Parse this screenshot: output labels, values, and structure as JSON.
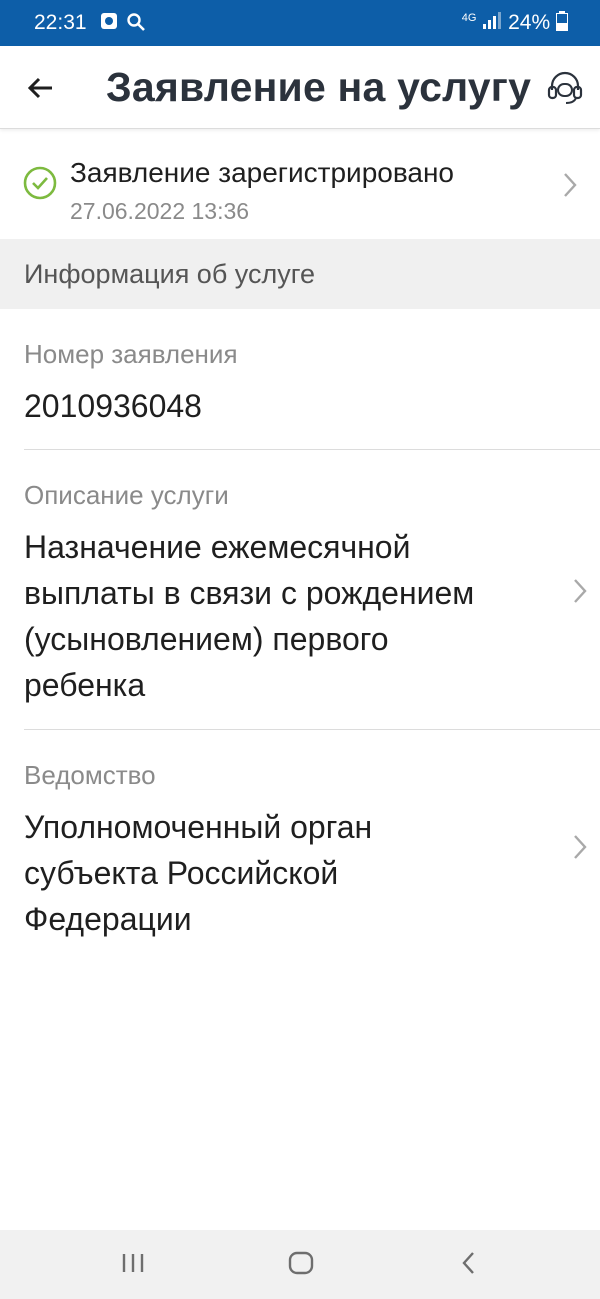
{
  "status_bar": {
    "time": "22:31",
    "network": "4G",
    "battery": "24%",
    "icons": [
      "notification-icon",
      "search-icon",
      "signal-icon",
      "battery-icon"
    ]
  },
  "app_bar": {
    "title": "Заявление на услугу",
    "back_icon": "arrow-left-icon",
    "support_icon": "headset-icon"
  },
  "status": {
    "text": "Заявление зарегистрировано",
    "date": "27.06.2022 13:36",
    "color": "#7dba3f"
  },
  "section": {
    "title": "Информация об услуге"
  },
  "fields": [
    {
      "label": "Номер заявления",
      "value": "2010936048"
    },
    {
      "label": "Описание услуги",
      "value_lines": [
        "Назначение ежемесячной",
        "выплаты в связи с рождением",
        "(усыновлением) первого",
        "ребенка"
      ]
    },
    {
      "label": "Ведомство",
      "value_lines": [
        "Уполномоченный орган",
        "субъекта Российской",
        "Федерации"
      ]
    }
  ],
  "colors": {
    "status_bar": "#0d5ea8",
    "title": "#2b323c",
    "secondary_text": "#8a8a8a",
    "section_bg": "#f0f0f0"
  }
}
